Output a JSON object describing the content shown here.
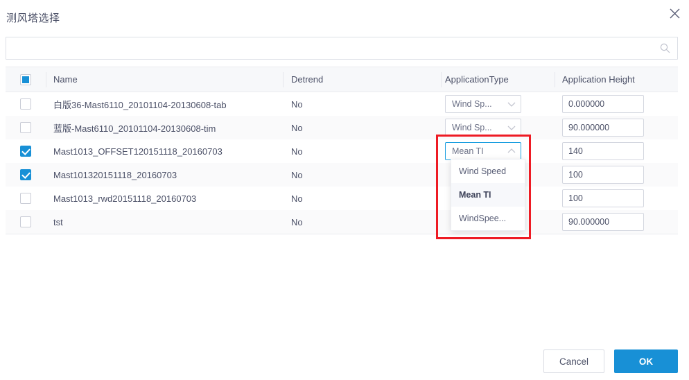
{
  "dialog": {
    "title": "测风塔选择",
    "close_icon": "close-icon"
  },
  "search": {
    "value": "",
    "placeholder": "",
    "icon": "search-icon"
  },
  "table": {
    "columns": [
      {
        "key": "select",
        "label": ""
      },
      {
        "key": "name",
        "label": "Name"
      },
      {
        "key": "detrend",
        "label": "Detrend"
      },
      {
        "key": "application_type",
        "label": "ApplicationType"
      },
      {
        "key": "application_height",
        "label": "Application Height"
      }
    ],
    "header_checkbox_state": "indeterminate",
    "rows": [
      {
        "checked": false,
        "name": "白版36-Mast6110_20101104-20130608-tab",
        "detrend": "No",
        "application_type": "Wind Sp...",
        "application_height": "0.000000",
        "type_open": false
      },
      {
        "checked": false,
        "name": "蓝版-Mast6110_20101104-20130608-tim",
        "detrend": "No",
        "application_type": "Wind Sp...",
        "application_height": "90.000000",
        "type_open": false
      },
      {
        "checked": true,
        "name": "Mast1013_OFFSET120151118_20160703",
        "detrend": "No",
        "application_type": "Mean TI",
        "application_height": "140",
        "type_open": true
      },
      {
        "checked": true,
        "name": "Mast101320151118_20160703",
        "detrend": "No",
        "application_type": "",
        "application_height": "100",
        "type_open": false
      },
      {
        "checked": false,
        "name": "Mast1013_rwd20151118_20160703",
        "detrend": "No",
        "application_type": "",
        "application_height": "100",
        "type_open": false
      },
      {
        "checked": false,
        "name": "tst",
        "detrend": "No",
        "application_type": "",
        "application_height": "90.000000",
        "type_open": false
      }
    ]
  },
  "dropdown": {
    "open": true,
    "selected": "Mean TI",
    "options": [
      {
        "label": "Wind Speed",
        "selected": false
      },
      {
        "label": "Mean TI",
        "selected": true
      },
      {
        "label": "WindSpee...",
        "selected": false
      }
    ]
  },
  "highlight": {
    "color": "#ee1b24",
    "note": "annotation-rectangle"
  },
  "footer": {
    "cancel_label": "Cancel",
    "ok_label": "OK"
  },
  "colors": {
    "accent": "#1890d6",
    "focus_border": "#1c9fe0",
    "annotation": "#ee1b24",
    "header_bg": "#f7f8fa",
    "stripe_bg": "#fafafb",
    "text": "#4a4f66"
  }
}
